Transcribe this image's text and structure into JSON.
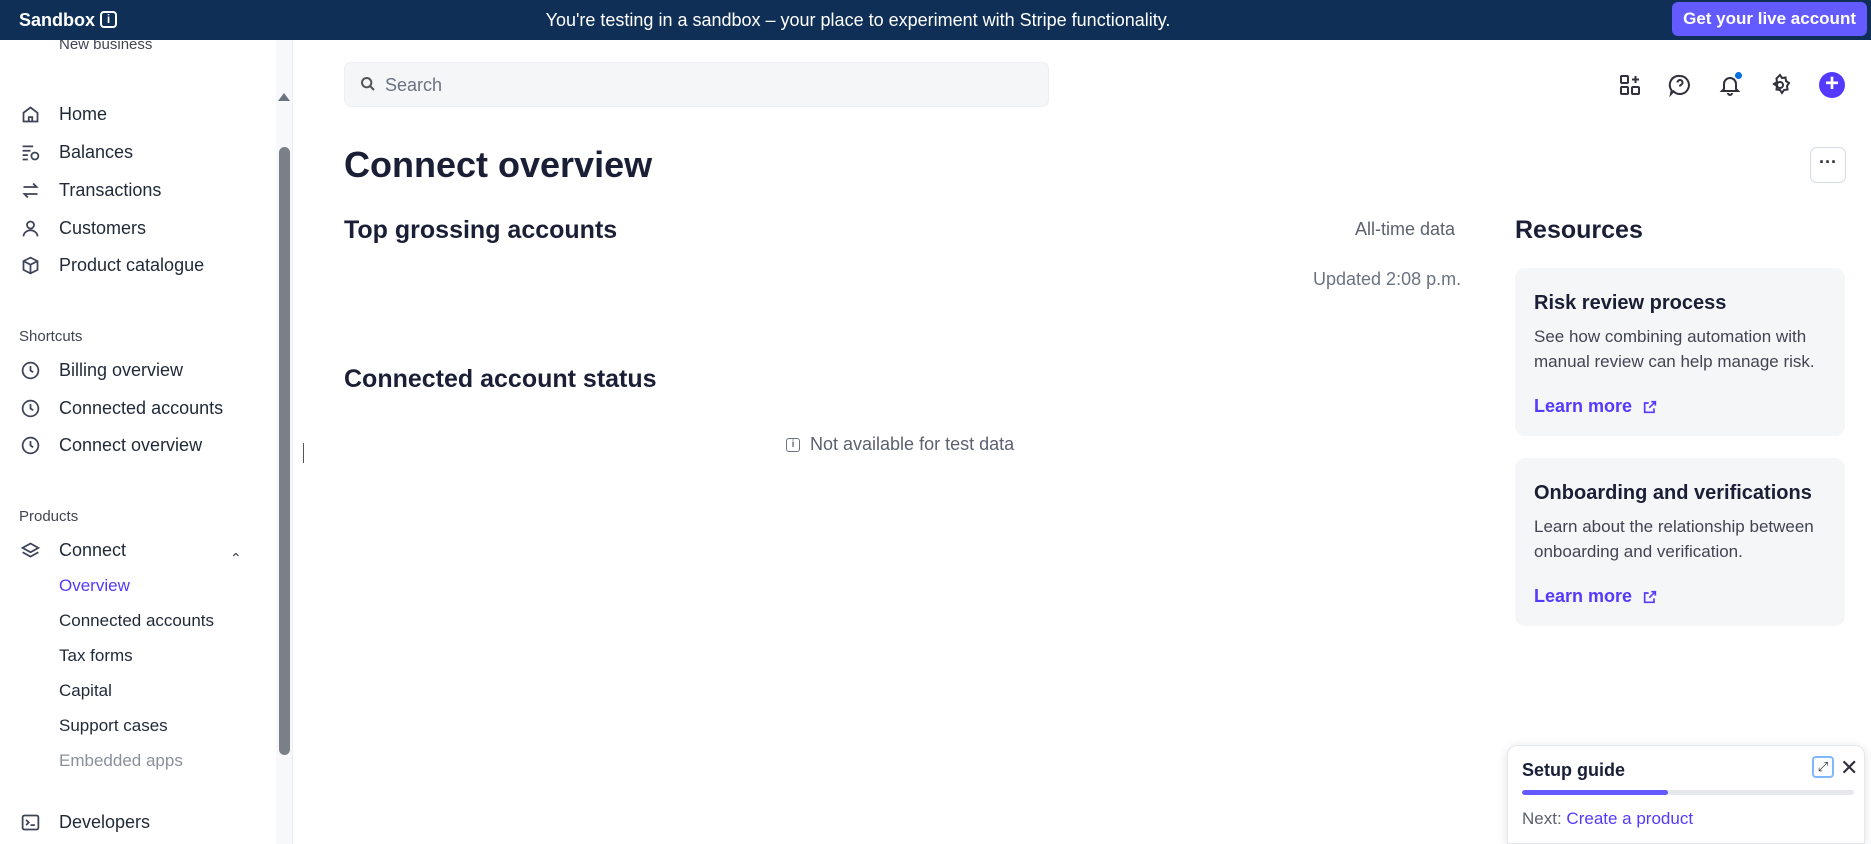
{
  "banner": {
    "brand": "Sandbox",
    "message": "You're testing in a sandbox – your place to experiment with Stripe functionality.",
    "live_button": "Get your live account"
  },
  "sidebar": {
    "cut_text": "New business",
    "main_items": [
      {
        "label": "Home",
        "icon": "home-icon"
      },
      {
        "label": "Balances",
        "icon": "balances-icon"
      },
      {
        "label": "Transactions",
        "icon": "transactions-icon"
      },
      {
        "label": "Customers",
        "icon": "customers-icon"
      },
      {
        "label": "Product catalogue",
        "icon": "product-catalogue-icon"
      }
    ],
    "shortcuts_label": "Shortcuts",
    "shortcuts": [
      {
        "label": "Billing overview",
        "icon": "clock-icon"
      },
      {
        "label": "Connected accounts",
        "icon": "clock-icon"
      },
      {
        "label": "Connect overview",
        "icon": "clock-icon"
      }
    ],
    "products_label": "Products",
    "connect_label": "Connect",
    "connect_subitems": [
      {
        "label": "Overview",
        "active": true
      },
      {
        "label": "Connected accounts"
      },
      {
        "label": "Tax forms"
      },
      {
        "label": "Capital"
      },
      {
        "label": "Support cases"
      },
      {
        "label": "Embedded apps"
      }
    ],
    "developers_label": "Developers"
  },
  "search": {
    "placeholder": "Search"
  },
  "page": {
    "title": "Connect overview",
    "top_grossing_title": "Top grossing accounts",
    "all_time": "All-time data",
    "updated": "Updated 2:08 p.m.",
    "status_title": "Connected account status",
    "not_available": "Not available for test data"
  },
  "resources": {
    "title": "Resources",
    "cards": [
      {
        "title": "Risk review process",
        "desc": "See how combining automation with manual review can help manage risk.",
        "link": "Learn more"
      },
      {
        "title": "Onboarding and verifications",
        "desc": "Learn about the relationship between onboarding and verification.",
        "link": "Learn more"
      }
    ]
  },
  "setup_guide": {
    "title": "Setup guide",
    "next_label": "Next:",
    "next_link": "Create a product",
    "progress_percent": 44
  },
  "colors": {
    "banner": "#0f2f57",
    "accent": "#533afd",
    "live_button": "#635bff"
  }
}
